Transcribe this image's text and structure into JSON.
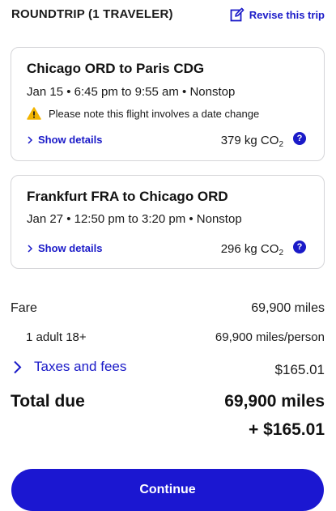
{
  "header": {
    "title": "ROUNDTRIP (1 TRAVELER)",
    "revise_label": "Revise this trip",
    "revise_icon": "edit-icon"
  },
  "flights": [
    {
      "route": "Chicago ORD to Paris CDG",
      "timing": "Jan 15 • 6:45 pm to 9:55 am • Nonstop",
      "warning": "Please note this flight involves a date change",
      "details_label": "Show details",
      "co2_value": "379 kg CO",
      "co2_sub": "2",
      "help_label": "?"
    },
    {
      "route": "Frankfurt FRA to Chicago ORD",
      "timing": "Jan 27 • 12:50 pm to 3:20 pm • Nonstop",
      "details_label": "Show details",
      "co2_value": "296 kg CO",
      "co2_sub": "2",
      "help_label": "?"
    }
  ],
  "summary": {
    "fare_label": "Fare",
    "fare_value": "69,900 miles",
    "adult_label": "1 adult 18+",
    "adult_value": "69,900 miles/person",
    "taxes_label": "Taxes and fees",
    "taxes_value": "$165.01",
    "total_label": "Total due",
    "total_miles": "69,900 miles",
    "total_usd": "+ $165.01"
  },
  "continue_label": "Continue",
  "colors": {
    "accent": "#1a1ac8",
    "button": "#1b17d1",
    "warning": "#f2b400",
    "border": "#d5d5d8"
  }
}
